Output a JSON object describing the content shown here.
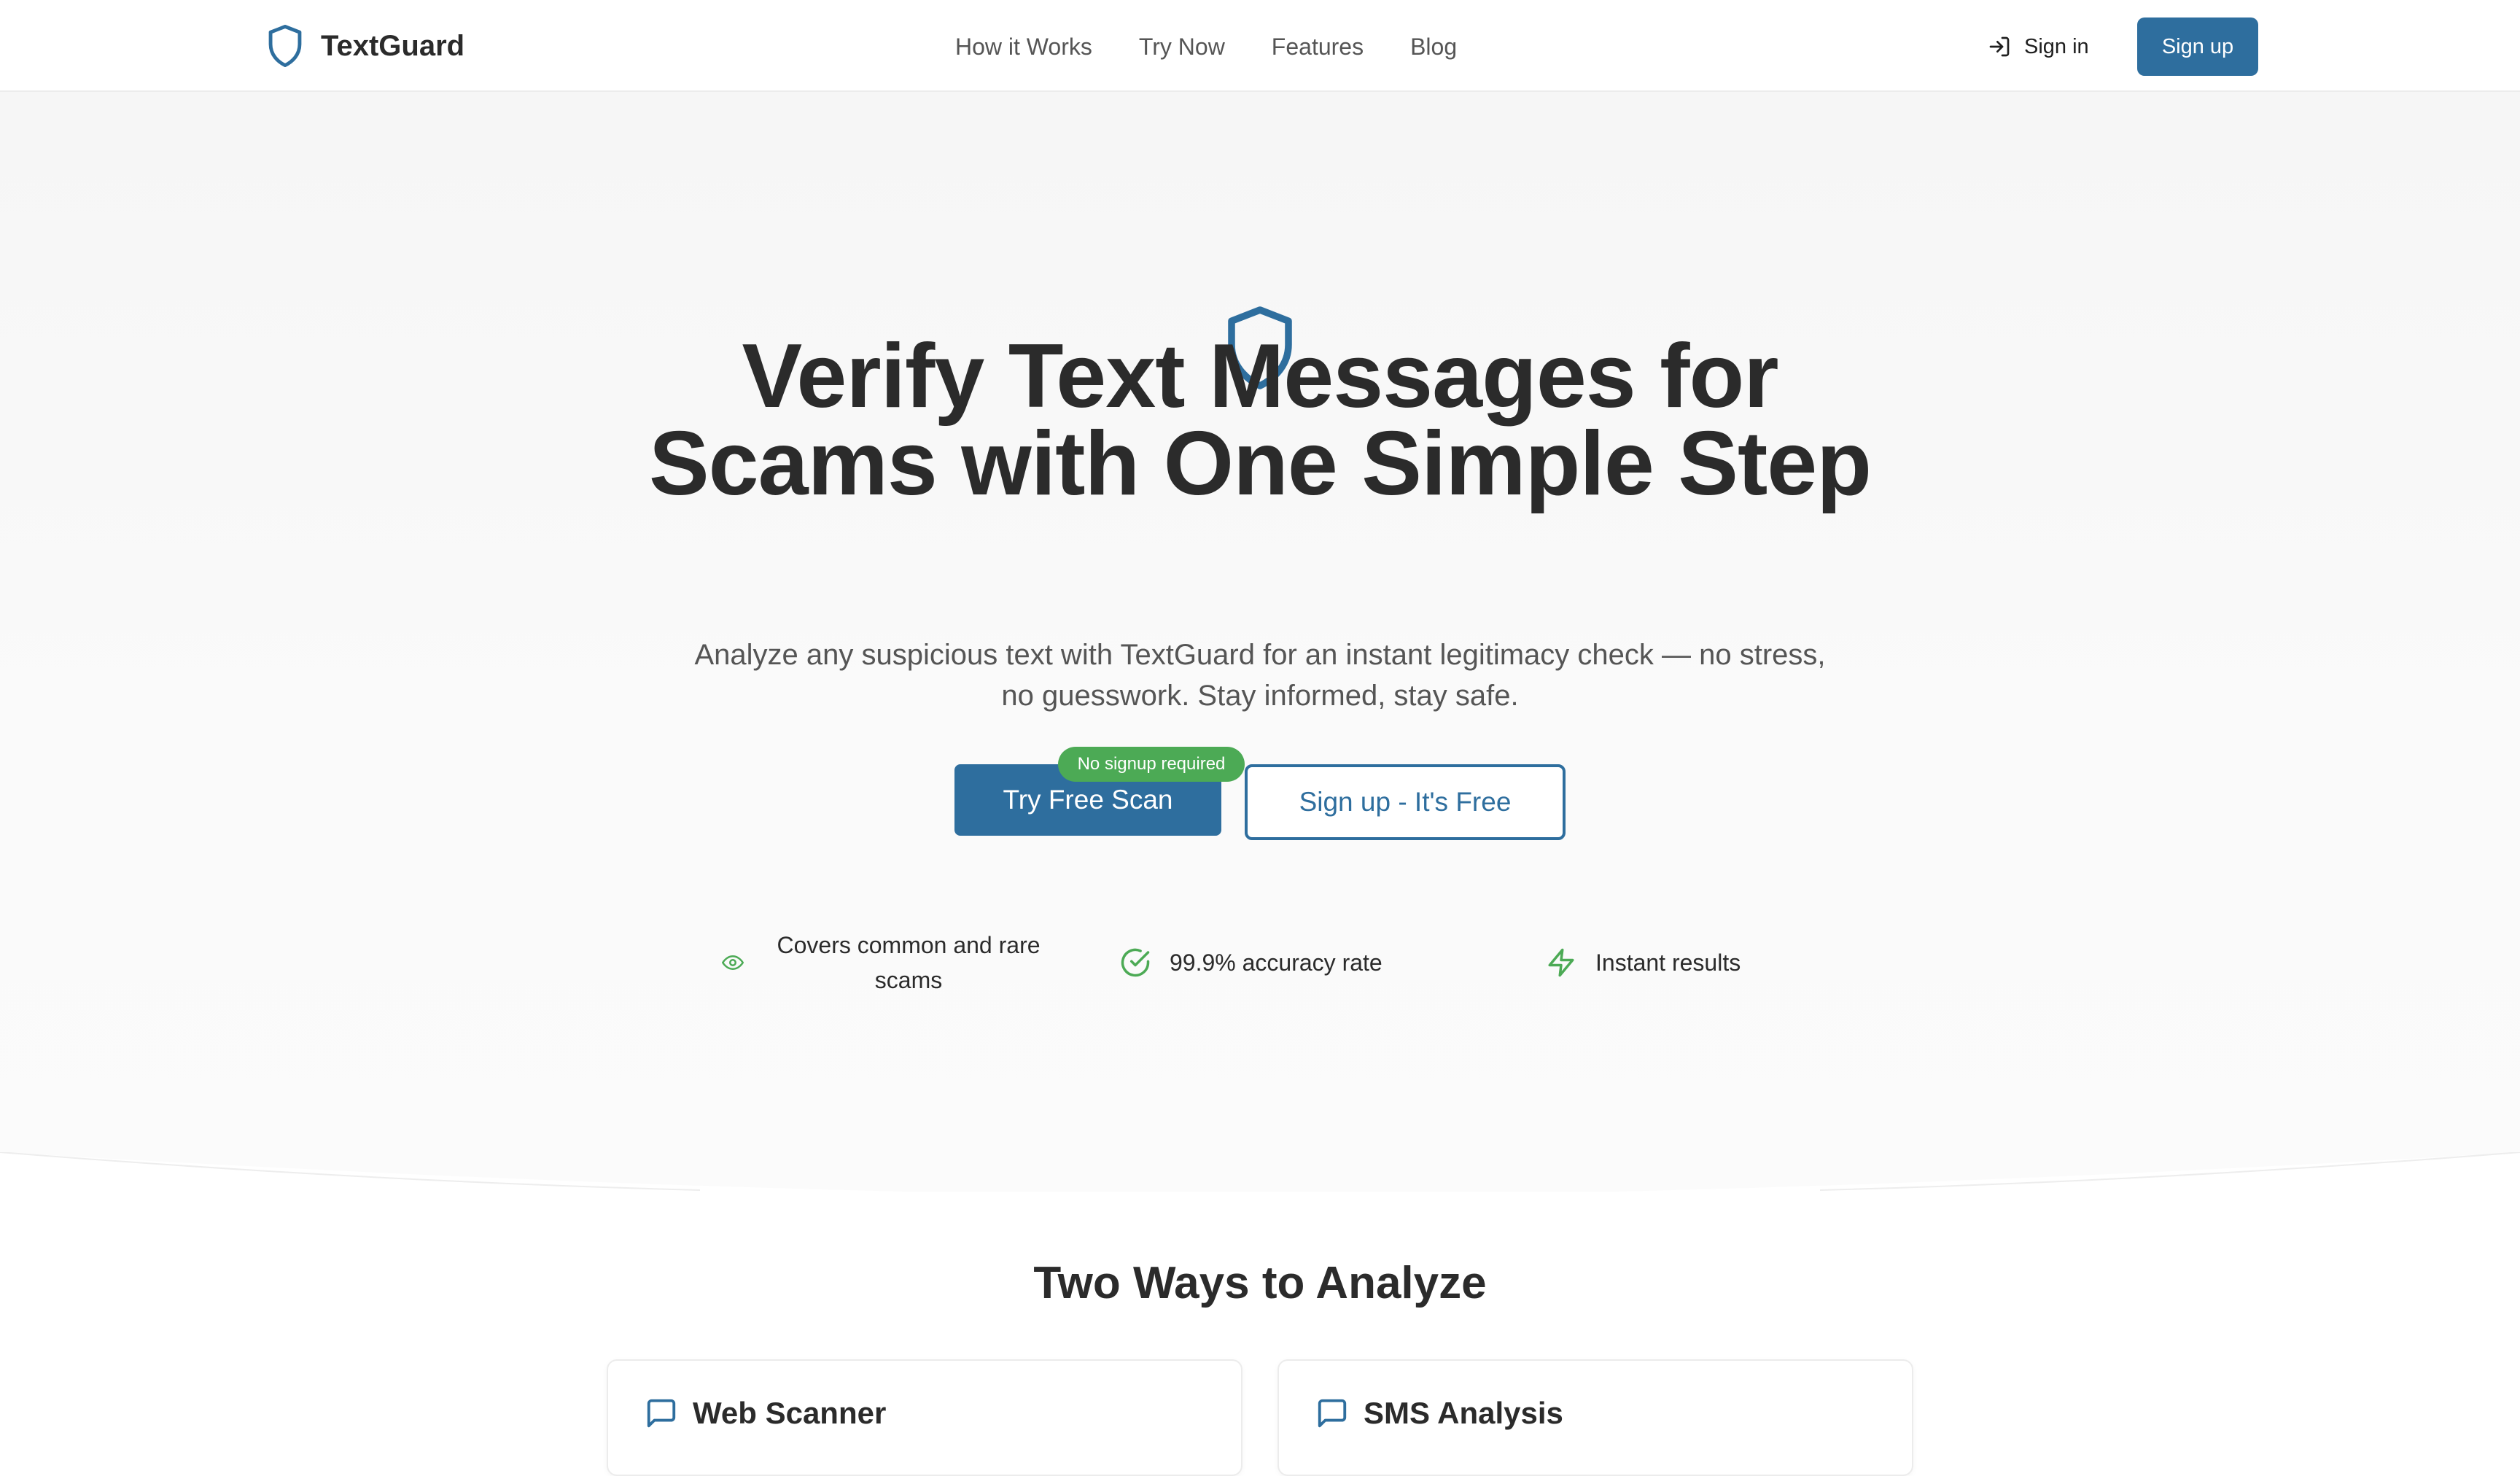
{
  "brand": {
    "name": "TextGuard"
  },
  "nav": {
    "links": [
      "How it Works",
      "Try Now",
      "Features",
      "Blog"
    ],
    "signin_label": "Sign in",
    "signup_label": "Sign up"
  },
  "hero": {
    "title": "Verify Text Messages for Scams with One Simple Step",
    "subtitle": "Analyze any suspicious text with TextGuard for an instant legitimacy check — no stress, no guesswork. Stay informed, stay safe.",
    "primary_cta": "Try Free Scan",
    "badge": "No signup required",
    "secondary_cta": "Sign up - It's Free"
  },
  "features": [
    {
      "icon": "eye-icon",
      "label": "Covers common and rare scams"
    },
    {
      "icon": "check-circle-icon",
      "label": "99.9% accuracy rate"
    },
    {
      "icon": "lightning-icon",
      "label": "Instant results"
    }
  ],
  "section": {
    "title": "Two Ways to Analyze",
    "cards": [
      {
        "icon": "message-square-icon",
        "title": "Web Scanner"
      },
      {
        "icon": "message-square-icon",
        "title": "SMS Analysis"
      }
    ]
  },
  "colors": {
    "primary": "#2e6e9e",
    "badge_green": "#4caa55",
    "feature_green": "#4caa55",
    "text_dark": "#2b2b2b",
    "text_muted": "#555555"
  }
}
